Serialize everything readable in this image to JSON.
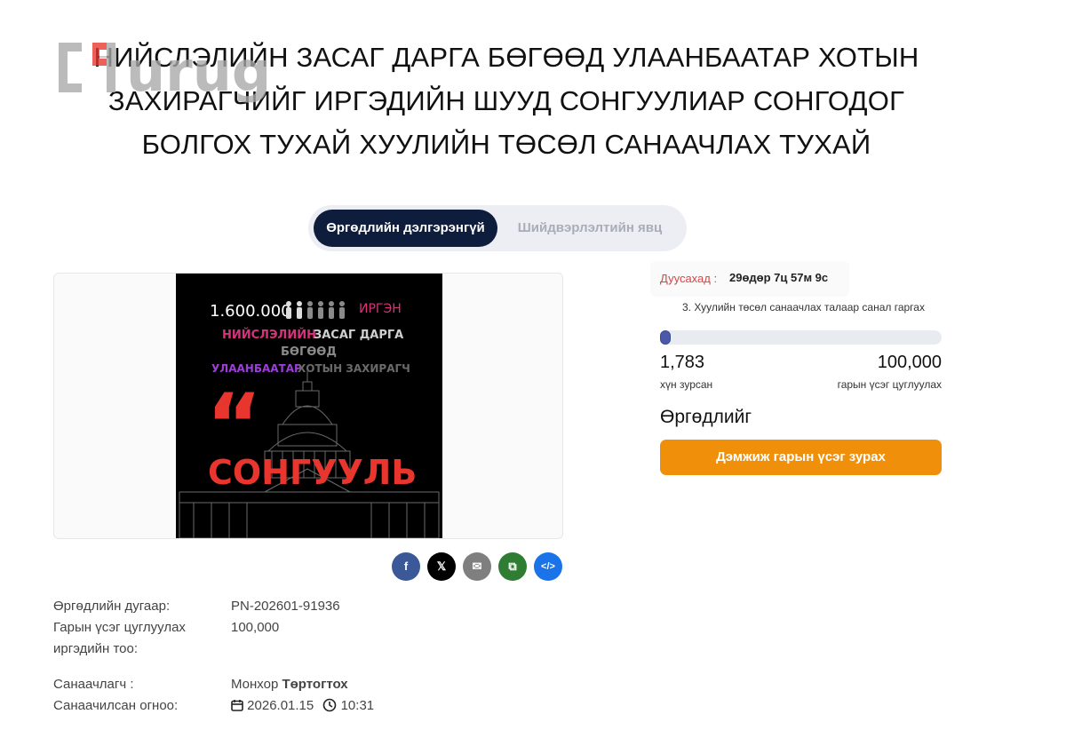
{
  "page": {
    "title_lines": [
      "НИЙСЛЭЛИЙН ЗАСАГ ДАРГА БӨГӨӨД УЛААНБААТАР ХОТЫН",
      "ЗАХИРАГЧИЙГ ИРГЭДИЙН ШУУД СОНГУУЛИАР СОНГОДОГ",
      "БОЛГОХ ТУХАЙ ХУУЛИЙН ТӨСӨЛ САНААЧЛАХ ТУХАЙ"
    ],
    "logo_text": "urug"
  },
  "tabs": [
    {
      "label": "Өргөдлийн дэлгэрэнгүй",
      "active": true
    },
    {
      "label": "Шийдвэрлэлтийн явц",
      "active": false
    }
  ],
  "poster": {
    "count": "1.600.000",
    "citizens": "ИРГЭН",
    "line2_a": "НИЙСЛЭЛИЙН",
    "line2_b": "ЗАСАГ ДАРГА",
    "line3": "БӨГӨӨД",
    "line4_a": "УЛААНБААТАР",
    "line4_b": "ХОТЫН ЗАХИРАГЧ",
    "quote": "“",
    "big": "СОНГУУЛЬ",
    "colors": {
      "red": "#e8362e",
      "purple": "#9b3fd6",
      "magenta": "#d7337a",
      "gray": "#8a8a8a"
    }
  },
  "share": [
    {
      "name": "facebook",
      "glyph": "f",
      "color": "#3b5998"
    },
    {
      "name": "x",
      "glyph": "𝕏",
      "color": "#000000"
    },
    {
      "name": "email",
      "glyph": "✉",
      "color": "#7f7f7f"
    },
    {
      "name": "copy",
      "glyph": "⧉",
      "color": "#2e7d32"
    },
    {
      "name": "embed",
      "glyph": "</>",
      "color": "#1a73e8"
    }
  ],
  "details": {
    "number_label": "Өргөдлийн дугаар:",
    "number_value": "PN-202601-91936",
    "goal_label_1": "Гарын үсэг цуглуулах",
    "goal_label_2": "иргэдийн тоо:",
    "goal_value": "100,000",
    "initiator_label": "Санаачлагч :",
    "initiator_first": "Монхор",
    "initiator_last": "Төртогтох",
    "date_label": "Санаачилсан огноо:",
    "date_value": "2026.01.15",
    "time_value": "10:31"
  },
  "sidebar": {
    "deadline_label": "Дуусахад :",
    "deadline_value": "29өдөр 7ц 57м 9с",
    "stage": "3. Хуулийн төсөл санаачлах талаар санал гаргах",
    "signed": "1,783",
    "signed_label": "хүн зурсан",
    "goal": "100,000",
    "goal_label": "гарын үсэг цуглуулах",
    "progress_fraction": 0.01783,
    "petition_heading": "Өргөдлийг",
    "sign_button": "Дэмжиж гарын үсэг зурах",
    "accent": "#f0900a"
  }
}
